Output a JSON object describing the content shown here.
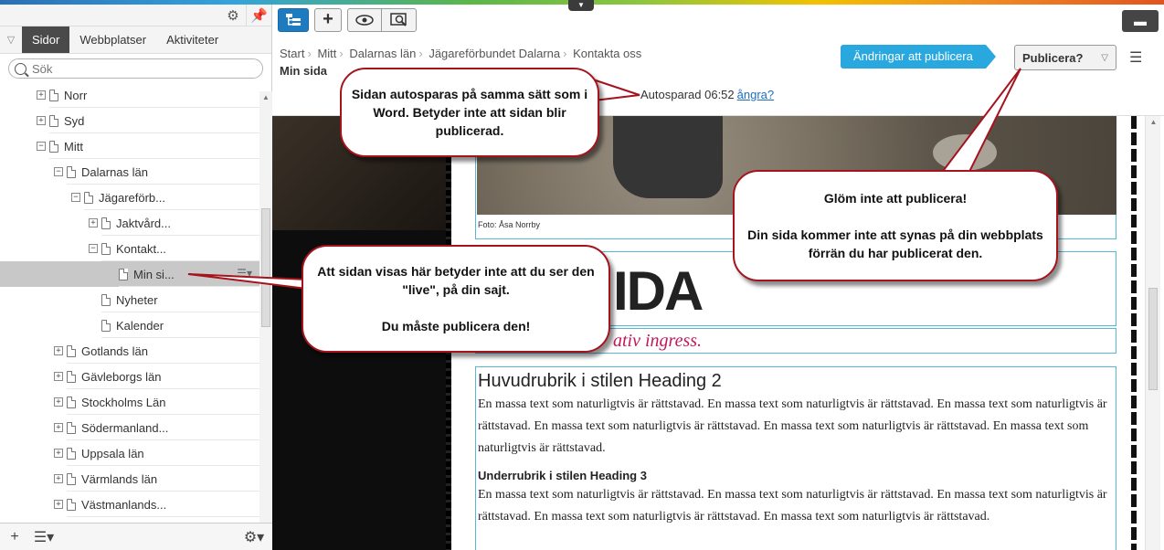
{
  "left_pane": {
    "tabs": [
      {
        "label": "Sidor",
        "active": true
      },
      {
        "label": "Webbplatser"
      },
      {
        "label": "Aktiviteter"
      }
    ],
    "search_placeholder": "Sök",
    "tree": [
      {
        "label": "Norr",
        "level": 0,
        "expander": "+"
      },
      {
        "label": "Syd",
        "level": 0,
        "expander": "+"
      },
      {
        "label": "Mitt",
        "level": 0,
        "expander": "−"
      },
      {
        "label": "Dalarnas län",
        "level": 1,
        "expander": "−"
      },
      {
        "label": "Jägareförb...",
        "level": 2,
        "expander": "−"
      },
      {
        "label": "Jaktvård...",
        "level": 3,
        "expander": "+"
      },
      {
        "label": "Kontakt...",
        "level": 3,
        "expander": "−"
      },
      {
        "label": "Min si...",
        "level": 4,
        "expander": "",
        "selected": true
      },
      {
        "label": "Nyheter",
        "level": 3,
        "expander": ""
      },
      {
        "label": "Kalender",
        "level": 3,
        "expander": ""
      },
      {
        "label": "Gotlands län",
        "level": 1,
        "expander": "+"
      },
      {
        "label": "Gävleborgs län",
        "level": 1,
        "expander": "+"
      },
      {
        "label": "Stockholms Län",
        "level": 1,
        "expander": "+"
      },
      {
        "label": "Södermanland...",
        "level": 1,
        "expander": "+"
      },
      {
        "label": "Uppsala län",
        "level": 1,
        "expander": "+"
      },
      {
        "label": "Värmlands län",
        "level": 1,
        "expander": "+"
      },
      {
        "label": "Västmanlands...",
        "level": 1,
        "expander": "+"
      }
    ]
  },
  "toolbar": {
    "breadcrumb": [
      "Start",
      "Mitt",
      "Dalarnas län",
      "Jägareförbundet Dalarna",
      "Kontakta oss"
    ],
    "page_title": "Min sida",
    "changes_label": "Ändringar att publicera",
    "publish_label": "Publicera?",
    "autosave_text": "Autosparad 06:52",
    "undo_link": "ångra?"
  },
  "content": {
    "photo_caption": "Foto: Åsa Norrby",
    "big_heading_fragment": "IDA",
    "ingress_fragment": "ativ ingress.",
    "heading2": "Huvudrubrik i stilen Heading 2",
    "paragraph1": "En massa text som naturligtvis är rättstavad. En massa text som naturligtvis är rättstavad. En massa text som naturligtvis är rättstavad. En massa text som naturligtvis är rättstavad. En massa text som naturligtvis är rättstavad. En massa text som naturligtvis är rättstavad.",
    "heading3": "Underrubrik i stilen Heading 3",
    "paragraph2": "En massa text som naturligtvis är rättstavad. En massa text som naturligtvis är rättstavad. En massa text som naturligtvis är rättstavad. En massa text som naturligtvis är rättstavad. En massa text som naturligtvis är rättstavad."
  },
  "callouts": {
    "autosave": "Sidan autosparas på samma sätt som i  Word. Betyder inte att sidan blir publicerad.",
    "publish": "Glöm inte att publicera!\n\nDin sida kommer inte att synas på din webbplats förrän du har publicerat den.",
    "live": "Att sidan visas här betyder inte att du ser den \"live\", på din sajt.\n\nDu måste publicera den!"
  },
  "colors": {
    "accent_blue": "#1e7bc0",
    "changes_blue": "#29a8e0",
    "callout_border": "#a5141d",
    "ingress_pink": "#c2185b",
    "frame_cyan": "#57b8d6"
  }
}
